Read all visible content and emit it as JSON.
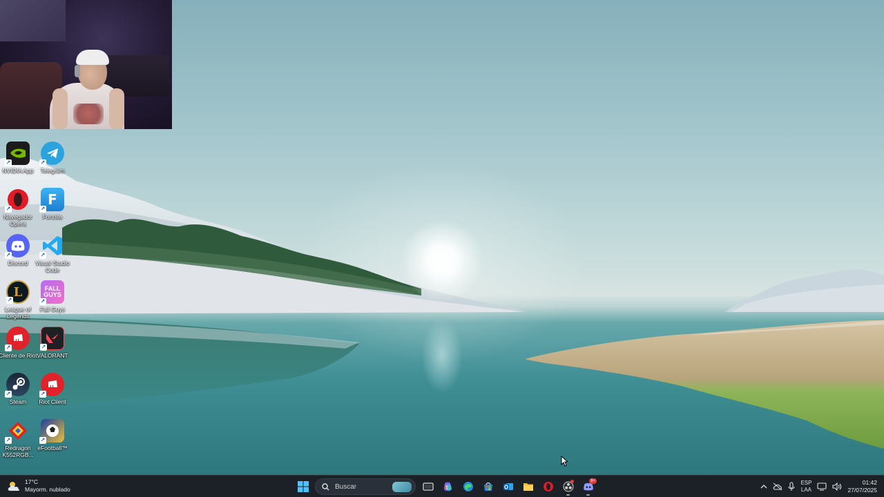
{
  "desktop": {
    "icons": [
      {
        "label": "NVIDIA App",
        "icon": "nvidia-icon"
      },
      {
        "label": "Telegram",
        "icon": "telegram-icon"
      },
      {
        "label": "Navegador Opera",
        "icon": "opera-icon"
      },
      {
        "label": "Fortnite",
        "icon": "fortnite-icon"
      },
      {
        "label": "Discord",
        "icon": "discord-icon"
      },
      {
        "label": "Visual Studio Code",
        "icon": "vscode-icon"
      },
      {
        "label": "League of Legends",
        "icon": "league-icon"
      },
      {
        "label": "Fall Guys",
        "icon": "fallguys-icon"
      },
      {
        "label": "Cliente de Riot",
        "icon": "riot-icon"
      },
      {
        "label": "VALORANT",
        "icon": "valorant-icon"
      },
      {
        "label": "Steam",
        "icon": "steam-icon"
      },
      {
        "label": "Riot Client",
        "icon": "riot-icon"
      },
      {
        "label": "Redragon K552RGB...",
        "icon": "redragon-icon"
      },
      {
        "label": "eFootball™",
        "icon": "efootball-icon"
      }
    ]
  },
  "taskbar": {
    "weather": {
      "temp": "17°C",
      "desc": "Mayorm. nublado"
    },
    "search_placeholder": "Buscar",
    "apps": [
      "start-icon",
      "task-view-icon",
      "copilot-icon",
      "edge-icon",
      "store-icon",
      "outlook-icon",
      "file-explorer-icon",
      "opera-icon",
      "obs-icon",
      "discord-icon"
    ],
    "discord_badge": "9+",
    "tray": {
      "lang": "ESP",
      "layout": "LAA"
    },
    "clock": {
      "time": "01:42",
      "date": "27/07/2025"
    }
  },
  "colors": {
    "taskbar_bg": "#1c2128",
    "accent": "#4cc2ff"
  }
}
